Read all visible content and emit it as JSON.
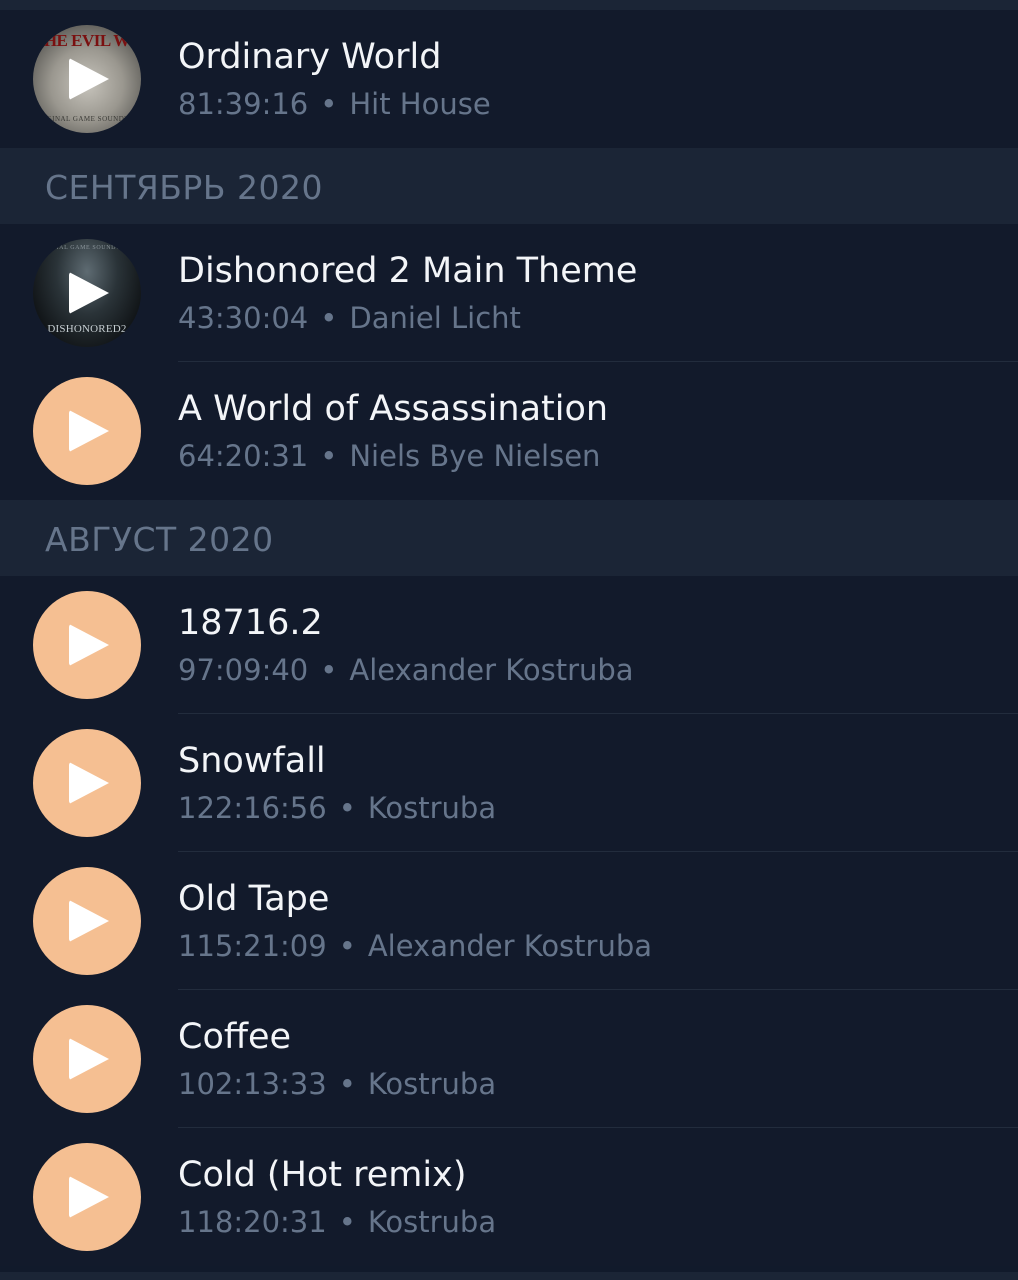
{
  "sections": [
    {
      "header": "",
      "tracks": [
        {
          "title": "Ordinary World",
          "duration": "81:39:16",
          "artist": "Hit House",
          "cover": "art-evil",
          "cover_top": "THE EVIL WITHIN",
          "cover_bottom": "ORIGINAL GAME SOUNDTRACK"
        }
      ]
    },
    {
      "header": "СЕНТЯБРЬ 2020",
      "tracks": [
        {
          "title": "Dishonored 2 Main Theme",
          "duration": "43:30:04",
          "artist": "Daniel Licht",
          "cover": "art-dishonored",
          "cover_top": "ORIGINAL GAME SOUNDTRACK",
          "cover_bottom": "DISHONORED2"
        },
        {
          "title": "A World of Assassination",
          "duration": "64:20:31",
          "artist": "Niels Bye Nielsen",
          "cover": "plain"
        }
      ]
    },
    {
      "header": "АВГУСТ 2020",
      "tracks": [
        {
          "title": "18716.2",
          "duration": "97:09:40",
          "artist": "Alexander Kostruba",
          "cover": "plain"
        },
        {
          "title": "Snowfall",
          "duration": "122:16:56",
          "artist": "Kostruba",
          "cover": "plain"
        },
        {
          "title": "Old Tape",
          "duration": "115:21:09",
          "artist": "Alexander Kostruba",
          "cover": "plain"
        },
        {
          "title": "Coffee",
          "duration": "102:13:33",
          "artist": "Kostruba",
          "cover": "plain"
        },
        {
          "title": "Cold (Hot remix)",
          "duration": "118:20:31",
          "artist": "Kostruba",
          "cover": "plain"
        }
      ]
    }
  ],
  "separator": "•",
  "colors": {
    "background": "#111a2b",
    "section_background": "#1b2536",
    "play_circle": "#f5bf92",
    "title_text": "#f3f5f8",
    "secondary_text": "#66758b"
  },
  "icons": {
    "play": "play-icon"
  }
}
